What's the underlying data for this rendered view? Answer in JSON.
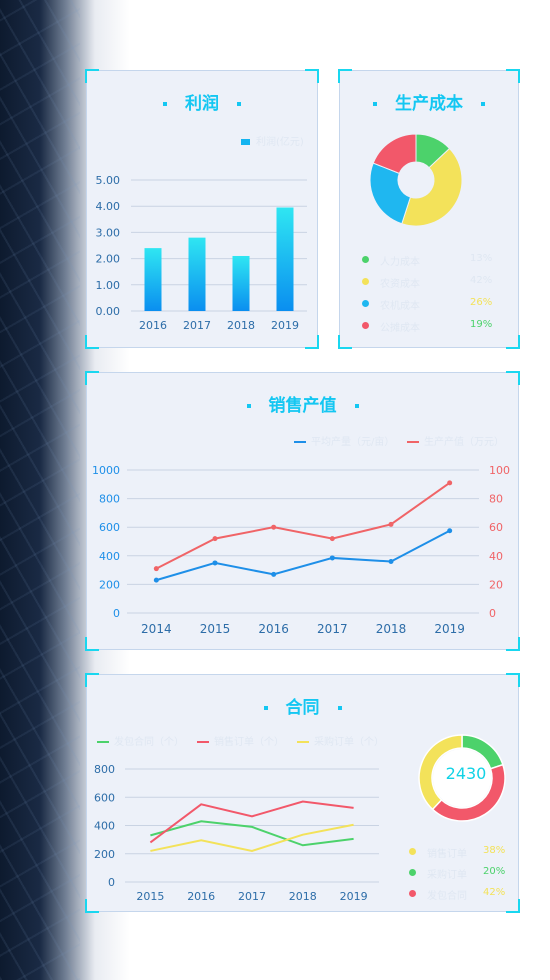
{
  "panels": {
    "profit": {
      "title": "利润",
      "legend": "利润(亿元)",
      "chart_data": {
        "type": "bar",
        "categories": [
          "2016",
          "2017",
          "2018",
          "2019"
        ],
        "series": [
          {
            "name": "利润(亿元)",
            "values": [
              2.4,
              2.8,
              2.1,
              3.95
            ]
          }
        ],
        "yticks": [
          "0.00",
          "1.00",
          "2.00",
          "3.00",
          "4.00",
          "5.00"
        ],
        "ylim": [
          0,
          5
        ]
      }
    },
    "cost": {
      "title": "生产成本",
      "chart_data": {
        "type": "pie",
        "labels": [
          "人力成本",
          "农资成本",
          "农机成本",
          "公摊成本"
        ],
        "percents": [
          "13%",
          "42%",
          "26%",
          "19%"
        ],
        "values": [
          13,
          42,
          26,
          19
        ],
        "colors": [
          "#4cd26b",
          "#f3e25a",
          "#1fb7f0",
          "#f2586a"
        ]
      }
    },
    "sales": {
      "title": "销售产值",
      "legend": [
        "平均产量（元/亩）",
        "生产产值（万元）"
      ],
      "chart_data": {
        "type": "line",
        "x": [
          "2014",
          "2015",
          "2016",
          "2017",
          "2018",
          "2019"
        ],
        "series": [
          {
            "name": "平均产量（元/亩）",
            "axis": "left",
            "color": "#1e8fe8",
            "values": [
              230,
              350,
              270,
              385,
              360,
              575
            ]
          },
          {
            "name": "生产产值（万元）",
            "axis": "right",
            "color": "#f06467",
            "values": [
              31,
              52,
              60,
              52,
              62,
              91
            ]
          }
        ],
        "yleft_ticks": [
          "0",
          "200",
          "400",
          "600",
          "800",
          "1000"
        ],
        "yright_ticks": [
          "0",
          "20",
          "40",
          "60",
          "80",
          "100"
        ],
        "ylim_left": [
          0,
          1000
        ],
        "ylim_right": [
          0,
          100
        ]
      }
    },
    "contract": {
      "title": "合同",
      "legend": [
        "发包合同（个）",
        "销售订单（个）",
        "采购订单（个）"
      ],
      "chart_data": {
        "type": "line",
        "x": [
          "2015",
          "2016",
          "2017",
          "2018",
          "2019"
        ],
        "series": [
          {
            "name": "发包合同（个）",
            "color": "#4cd26b",
            "values": [
              330,
              430,
              390,
              260,
              305
            ]
          },
          {
            "name": "销售订单（个）",
            "color": "#f2586a",
            "values": [
              280,
              550,
              465,
              570,
              525
            ]
          },
          {
            "name": "采购订单（个）",
            "color": "#f3e25a",
            "values": [
              220,
              295,
              220,
              335,
              405
            ]
          }
        ],
        "yticks": [
          "0",
          "200",
          "400",
          "600",
          "800"
        ],
        "ylim": [
          0,
          800
        ]
      },
      "donut": {
        "total": "2430",
        "labels": [
          "销售订单",
          "采购订单",
          "发包合同"
        ],
        "percents": [
          "38%",
          "20%",
          "42%"
        ],
        "values": [
          38,
          20,
          42
        ],
        "colors": [
          "#f3e25a",
          "#4cd26b",
          "#f2586a"
        ]
      }
    }
  }
}
